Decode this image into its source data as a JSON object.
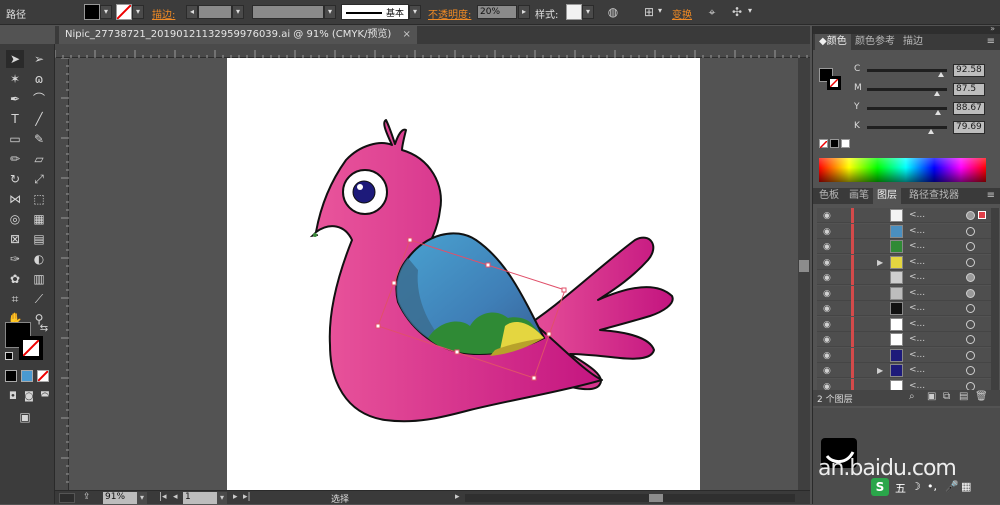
{
  "control_bar": {
    "label_path": "路径",
    "label_stroke": "描边:",
    "stroke_style": "基本",
    "label_opacity": "不透明度:",
    "opacity_value": "20%",
    "label_style": "样式:",
    "label_transform": "变换"
  },
  "document": {
    "tab_title": "Nipic_27738721_20190121132959976039.ai @ 91% (CMYK/预览)",
    "close_glyph": "×"
  },
  "status_bar": {
    "zoom": "91%",
    "page": "1",
    "mode": "选择"
  },
  "color_panel": {
    "tabs": [
      "颜色",
      "颜色参考",
      "描边"
    ],
    "channels": [
      {
        "label": "C",
        "value": "92.58",
        "level": 0.93
      },
      {
        "label": "M",
        "value": "87.5",
        "level": 0.88
      },
      {
        "label": "Y",
        "value": "88.67",
        "level": 0.89
      },
      {
        "label": "K",
        "value": "79.69",
        "level": 0.8
      }
    ]
  },
  "layers_panel": {
    "tabs": [
      "色板",
      "画笔",
      "图层",
      "路径查找器"
    ],
    "rows": [
      {
        "thumb": "#f4f4f4",
        "name": "<...",
        "target": "double"
      },
      {
        "thumb": "#4a8fc0",
        "name": "<...",
        "target": "empty"
      },
      {
        "thumb": "#2f8a35",
        "name": "<...",
        "target": "empty"
      },
      {
        "thumb": "#e4d640",
        "name": "<...",
        "target": "empty",
        "expand": true
      },
      {
        "thumb": "#cfcfcf",
        "name": "<...",
        "target": "filled"
      },
      {
        "thumb": "#bdbdbd",
        "name": "<...",
        "target": "filled"
      },
      {
        "thumb": "#111111",
        "name": "<...",
        "target": "empty"
      },
      {
        "thumb": "#ffffff",
        "name": "<...",
        "target": "empty"
      },
      {
        "thumb": "#ffffff",
        "name": "<...",
        "target": "empty"
      },
      {
        "thumb": "#1d1a7a",
        "name": "<...",
        "target": "empty"
      },
      {
        "thumb": "#1d1a7a",
        "name": "<...",
        "target": "empty",
        "expand": true
      },
      {
        "thumb": "#ffffff",
        "name": "<...",
        "target": "empty"
      }
    ],
    "footer_count": "2 个图层"
  },
  "watermark": {
    "text": "an.baidu.com",
    "ime_label": "五"
  },
  "colors": {
    "bird_pink": "#d21a7e",
    "wing_blue": "#4aa3d1",
    "wing_green": "#2f8a35",
    "selection_red": "#e0506a",
    "accent_orange": "#f08a24"
  }
}
